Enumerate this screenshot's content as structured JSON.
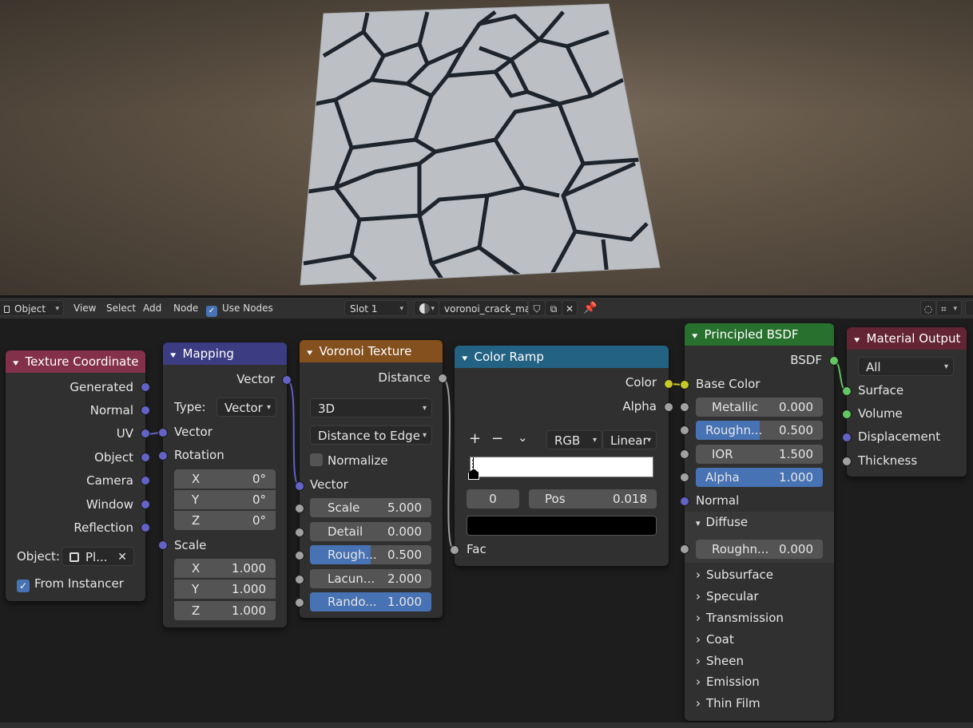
{
  "header": {
    "mode": "Object",
    "menus": [
      "View",
      "Select",
      "Add",
      "Node"
    ],
    "use_nodes_label": "Use Nodes",
    "slot": "Slot 1",
    "material_name": "voronoi_crack_mat"
  },
  "nodes": {
    "texture_coordinate": {
      "title": "Texture Coordinate",
      "outputs": [
        "Generated",
        "Normal",
        "UV",
        "Object",
        "Camera",
        "Window",
        "Reflection"
      ],
      "object_label": "Object:",
      "object_value": "Pl...",
      "from_instancer": "From Instancer"
    },
    "mapping": {
      "title": "Mapping",
      "output": "Vector",
      "type_label": "Type:",
      "type_value": "Vector",
      "vector_in": "Vector",
      "rotation": "Rotation",
      "rotation_values": [
        {
          "axis": "X",
          "value": "0°"
        },
        {
          "axis": "Y",
          "value": "0°"
        },
        {
          "axis": "Z",
          "value": "0°"
        }
      ],
      "scale": "Scale",
      "scale_values": [
        {
          "axis": "X",
          "value": "1.000"
        },
        {
          "axis": "Y",
          "value": "1.000"
        },
        {
          "axis": "Z",
          "value": "1.000"
        }
      ]
    },
    "voronoi": {
      "title": "Voronoi Texture",
      "output": "Distance",
      "dimension": "3D",
      "feature": "Distance to Edge",
      "normalize": "Normalize",
      "vector_in": "Vector",
      "params": [
        {
          "label": "Scale",
          "value": "5.000"
        },
        {
          "label": "Detail",
          "value": "0.000"
        },
        {
          "label": "Rough...",
          "value": "0.500"
        },
        {
          "label": "Lacun...",
          "value": "2.000"
        },
        {
          "label": "Rando...",
          "value": "1.000"
        }
      ]
    },
    "color_ramp": {
      "title": "Color Ramp",
      "outputs": [
        "Color",
        "Alpha"
      ],
      "tools": {
        "add": "+",
        "remove": "−",
        "menu": "⌄"
      },
      "color_mode": "RGB",
      "interpolation": "Linear",
      "stop_index": "0",
      "pos_label": "Pos",
      "pos_value": "0.018",
      "input": "Fac"
    },
    "principled": {
      "title": "Principled BSDF",
      "output": "BSDF",
      "base_color": "Base Color",
      "params": [
        {
          "label": "Metallic",
          "value": "0.000"
        },
        {
          "label": "Roughn...",
          "value": "0.500"
        },
        {
          "label": "IOR",
          "value": "1.500"
        },
        {
          "label": "Alpha",
          "value": "1.000"
        }
      ],
      "normal": "Normal",
      "diffuse": "Diffuse",
      "diffuse_rough_label": "Roughn...",
      "diffuse_rough_value": "0.000",
      "panels": [
        "Subsurface",
        "Specular",
        "Transmission",
        "Coat",
        "Sheen",
        "Emission",
        "Thin Film"
      ]
    },
    "material_output": {
      "title": "Material Output",
      "target": "All",
      "inputs": [
        "Surface",
        "Volume",
        "Displacement",
        "Thickness"
      ]
    }
  },
  "colors": {
    "tex_coord_header": "#83314a",
    "mapping_header": "#3c3c83",
    "voronoi_header": "#83501e",
    "color_ramp_header": "#246283",
    "principled_header": "#27702d",
    "output_header": "#632434",
    "accent": "#4772b3"
  }
}
